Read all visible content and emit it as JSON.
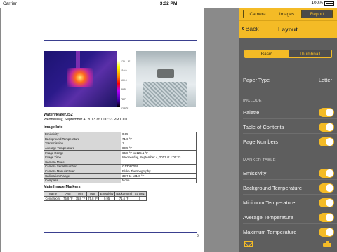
{
  "status": {
    "carrier": "Carrier",
    "time": "3:32 PM",
    "battery": "100%"
  },
  "tabs": [
    {
      "label": "Camera"
    },
    {
      "label": "Images"
    },
    {
      "label": "Report"
    }
  ],
  "nav": {
    "back_label": "Back",
    "title": "Layout"
  },
  "layout_options": {
    "basic": "Basic",
    "thumbnail": "Thumbnail"
  },
  "paper": {
    "label": "Paper Type",
    "value": "Letter"
  },
  "include": {
    "header": "INCLUDE",
    "items": [
      "Palette",
      "Table of Contents",
      "Page Numbers"
    ]
  },
  "marker_table": {
    "header": "MARKER TABLE",
    "items": [
      "Emissivity",
      "Background Temperature",
      "Minimum Temperature",
      "Average Temperature",
      "Maximum Temperature"
    ]
  },
  "report": {
    "image_title": "WaterHeater.IS2",
    "image_date": "Wednesday, September 4, 2013 at 1:00:33 PM CDT",
    "palette_labels": [
      "125.1 °F",
      "110.9",
      "100.0",
      "89.5",
      "78.7",
      "62.8 °F"
    ],
    "image_info_title": "Image Info",
    "image_info": [
      [
        "Emissivity",
        "0.95"
      ],
      [
        "Background Temperature",
        "71.6 °F"
      ],
      [
        "Transmission",
        "1"
      ],
      [
        "Average Temperature",
        "89.5 °F"
      ],
      [
        "Image Range",
        "65.8 °F to 125.1 °F"
      ],
      [
        "Image Time",
        "Wednesday, September 4, 2013 at 1:00:33..."
      ],
      [
        "Camera Model",
        ""
      ],
      [
        "Camera Serial Number",
        "G13080059"
      ],
      [
        "Camera Manufacturer",
        "Fluke Thermography"
      ],
      [
        "Calibration Range",
        "39.7 to 131.0 °F"
      ],
      [
        "Compass",
        "None"
      ]
    ],
    "markers_title": "Main Image Markers",
    "marker_headers": [
      "Name",
      "Avg",
      "Min",
      "Max",
      "Emissivity",
      "Background",
      "St. Dev."
    ],
    "marker_rows": [
      [
        "Centerpoint",
        "75.8 °F",
        "75.8 °F",
        "75.8 °F",
        "0.95",
        "71.6 °F",
        "0"
      ]
    ],
    "page_number": "6"
  },
  "colors": {
    "accent": "#f4bb26",
    "sidebar": "#5e5e5e",
    "rule": "#3a3f8f"
  },
  "icons": {
    "mail": "mail-icon",
    "print": "print-icon",
    "back": "chevron-left-icon"
  }
}
